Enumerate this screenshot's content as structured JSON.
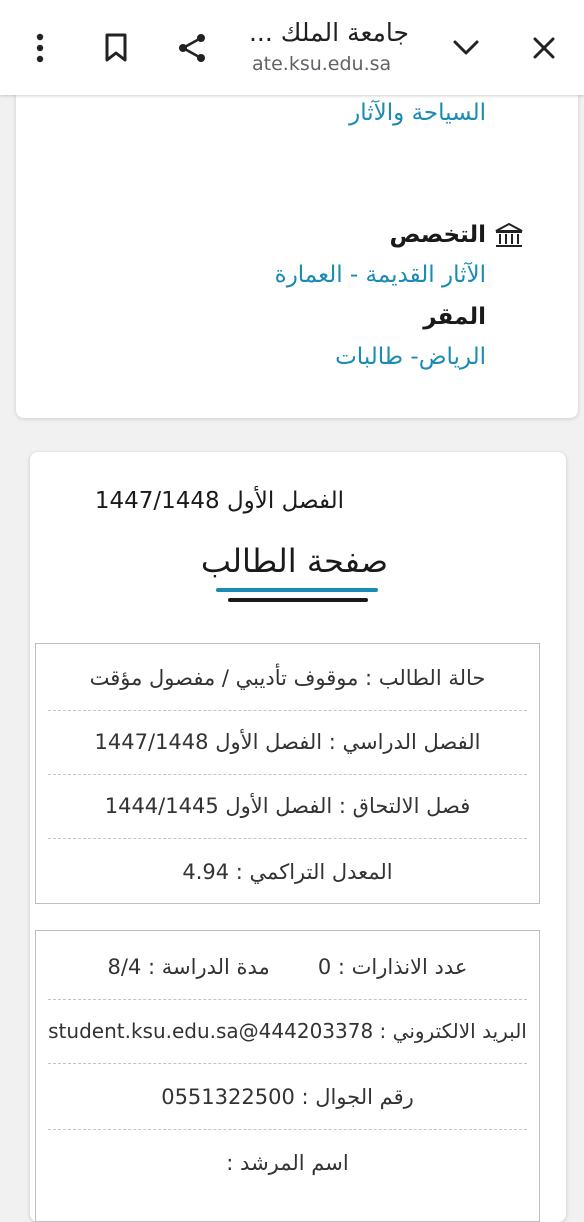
{
  "browser": {
    "title": "جامعة الملك ...",
    "url": "ate.ksu.edu.sa",
    "icons": {
      "close": "close-icon",
      "chevron": "chevron-down-icon",
      "share": "share-icon",
      "bookmark": "bookmark-icon",
      "menu": "more-vert-icon"
    }
  },
  "profile": {
    "college_value": "السياحة والآثار",
    "major_label": "التخصص",
    "major_value": "الآثار القديمة - العمارة",
    "campus_label": "المقر",
    "campus_value": "الرياض- طالبات",
    "icon": "institution-icon"
  },
  "student_page": {
    "semester": "الفصل الأول 1447/1448",
    "title": "صفحة الطالب",
    "status_rows": [
      "حالة الطالب : موقوف تأديبي / مفصول مؤقت",
      "الفصل الدراسي : الفصل الأول 1447/1448",
      "فصل الالتحاق : الفصل الأول 1444/1445",
      "المعدل التراكمي : 4.94"
    ],
    "warnings": "عدد الانذارات : 0",
    "study_duration": "مدة الدراسة : 8/4",
    "email": "البريد الالكتروني : student.ksu.edu.sa@444203378",
    "mobile": "رقم الجوال : 0551322500",
    "advisor": "اسم المرشد :"
  },
  "colors": {
    "accent": "#1a8bb3",
    "text": "#1a1a1a",
    "background": "#f1f1f1"
  }
}
